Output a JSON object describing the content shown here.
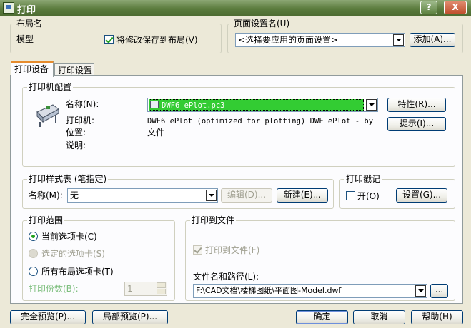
{
  "window": {
    "title": "打印",
    "help_button": "?",
    "close_button": "X"
  },
  "layout_group": {
    "label": "布局名",
    "layout_name": "模型",
    "save_changes_checkbox_label": "将修改保存到布局(V)",
    "save_changes_checked": true
  },
  "page_setup_group": {
    "label": "页面设置名(U)",
    "selected": "<选择要应用的页面设置>",
    "add_button": "添加(A)..."
  },
  "tabs": [
    {
      "label": "打印设备",
      "active": true
    },
    {
      "label": "打印设置",
      "active": false
    }
  ],
  "plotter_config": {
    "label": "打印机配置",
    "name_label": "名称(N):",
    "name_value": "DWF6 ePlot.pc3",
    "plotter_label": "打印机:",
    "plotter_value": "DWF6 ePlot (optimized for plotting) DWF ePlot - by",
    "location_label": "位置:",
    "location_value": "文件",
    "description_label": "说明:",
    "properties_button": "特性(R)...",
    "hints_button": "提示(I)...",
    "highlight_color": "#33cc33"
  },
  "plot_style_table": {
    "label": "打印样式表 (笔指定)",
    "name_label": "名称(M):",
    "name_value": "无",
    "edit_button": "编辑(D)...",
    "new_button": "新建(E)..."
  },
  "plot_stamp": {
    "label": "打印戳记",
    "on_label": "开(O)",
    "on_checked": false,
    "settings_button": "设置(G)..."
  },
  "what_to_plot": {
    "label": "打印范围",
    "options": [
      {
        "label": "当前选项卡(C)",
        "checked": true,
        "disabled": false
      },
      {
        "label": "选定的选项卡(S)",
        "checked": false,
        "disabled": true
      },
      {
        "label": "所有布局选项卡(T)",
        "checked": false,
        "disabled": false
      }
    ],
    "copies_label": "打印份数(B):",
    "copies_value": "1"
  },
  "plot_to_file": {
    "label": "打印到文件",
    "checkbox_label": "打印到文件(F)",
    "checkbox_checked": true,
    "path_label": "文件名和路径(L):",
    "path_value": "F:\\CAD文档\\楼梯图纸\\平面图-Model.dwf",
    "browse_button": "..."
  },
  "footer": {
    "full_preview": "完全预览(P)...",
    "partial_preview": "局部预览(P)...",
    "ok": "确定",
    "cancel": "取消",
    "help": "帮助(H)"
  }
}
